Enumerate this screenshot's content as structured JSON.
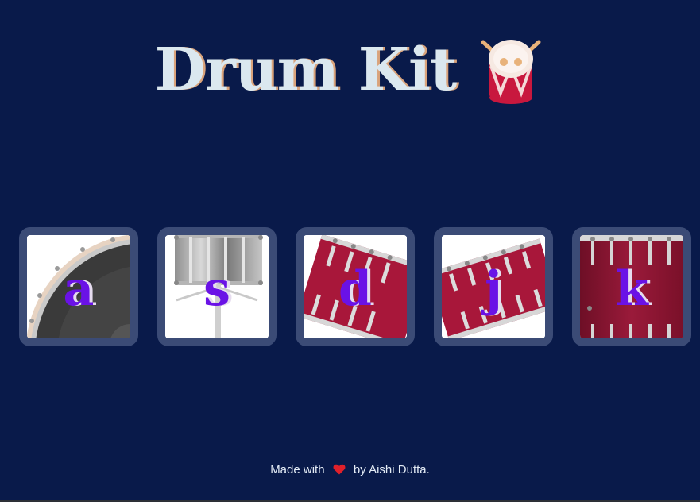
{
  "header": {
    "title": "Drum Kit",
    "icon": "drum-icon"
  },
  "drums": [
    {
      "key": "a",
      "drum": "kick-bass-icon"
    },
    {
      "key": "s",
      "drum": "snare-icon"
    },
    {
      "key": "d",
      "drum": "tom-1-icon"
    },
    {
      "key": "j",
      "drum": "tom-2-icon"
    },
    {
      "key": "k",
      "drum": "crash-icon"
    }
  ],
  "footer": {
    "prefix": "Made with",
    "icon": "heart-icon",
    "suffix": "by Aishi Dutta."
  },
  "colors": {
    "background": "#091a4a",
    "title": "#dbe8ef",
    "title_shadow": "#d9a37b",
    "button_border": "#3b4b76",
    "letter": "#6a12e6",
    "heart": "#e0202a"
  }
}
